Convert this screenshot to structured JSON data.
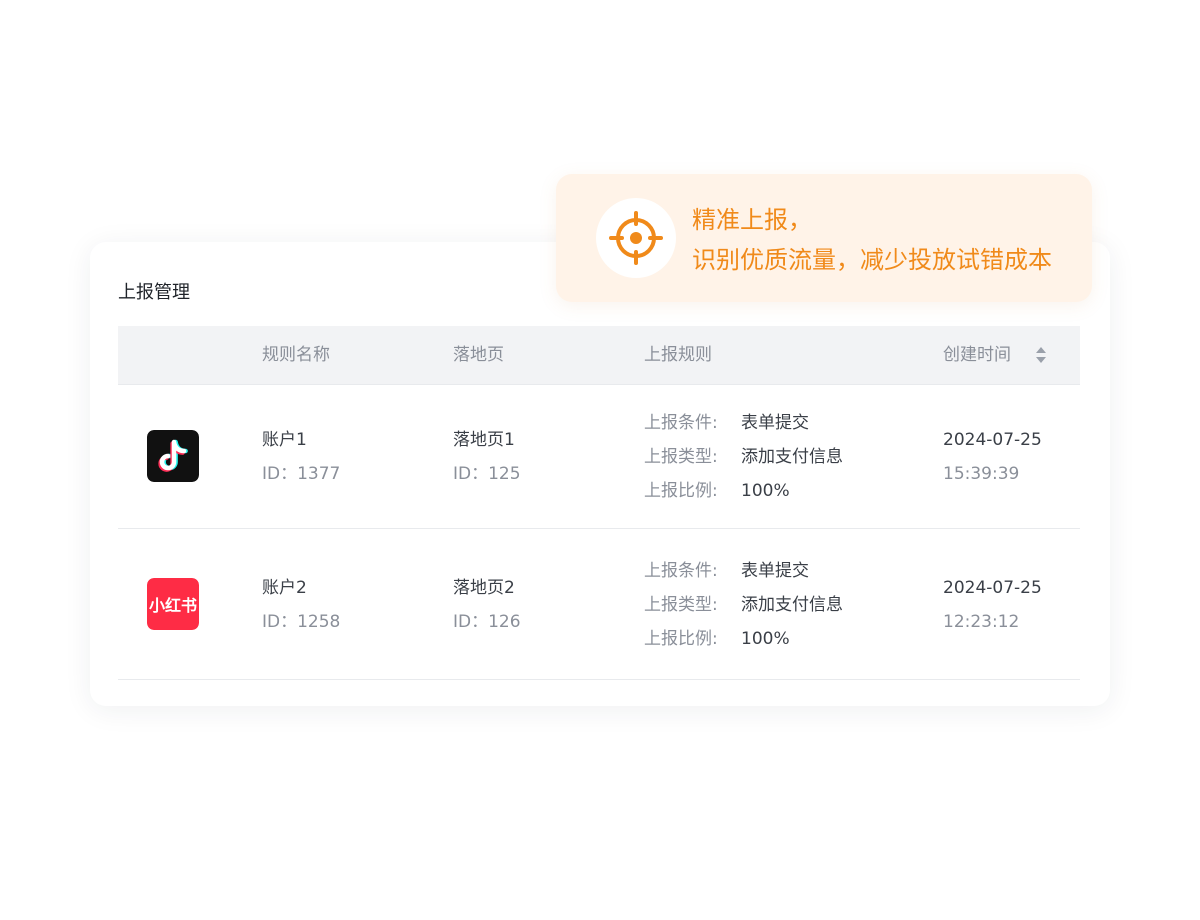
{
  "card": {
    "title": "上报管理"
  },
  "table": {
    "columns": [
      "规则名称",
      "落地页",
      "上报规则",
      "创建时间"
    ],
    "rows": [
      {
        "platform_icon": "tiktok-logo-icon",
        "rule_name": "账户1",
        "rule_id": "ID：1377",
        "landing_page": "落地页1",
        "landing_id": "ID：125",
        "rules": [
          {
            "key": "上报条件:",
            "value": "表单提交"
          },
          {
            "key": "上报类型:",
            "value": "添加支付信息"
          },
          {
            "key": "上报比例:",
            "value": "100%"
          }
        ],
        "date": "2024-07-25",
        "time": "15:39:39"
      },
      {
        "platform_icon": "xiaohongshu-logo-icon",
        "platform_label": "小红书",
        "rule_name": "账户2",
        "rule_id": "ID：1258",
        "landing_page": "落地页2",
        "landing_id": "ID：126",
        "rules": [
          {
            "key": "上报条件:",
            "value": "表单提交"
          },
          {
            "key": "上报类型:",
            "value": "添加支付信息"
          },
          {
            "key": "上报比例:",
            "value": "100%"
          }
        ],
        "date": "2024-07-25",
        "time": "12:23:12"
      }
    ]
  },
  "callout": {
    "icon": "target-icon",
    "line1": "精准上报，",
    "line2": "识别优质流量，减少投放试错成本"
  },
  "colors": {
    "accent_orange": "#f08a1a",
    "callout_bg": "#fff3e8",
    "header_bg": "#f2f3f5",
    "xiaohongshu_red": "#fe2c45",
    "tiktok_black": "#111111"
  }
}
